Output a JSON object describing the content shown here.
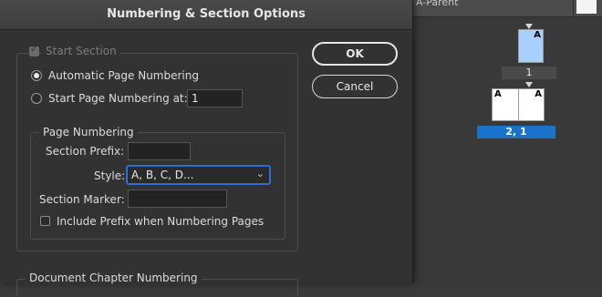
{
  "background_app": {
    "parent_label": "A-Parent",
    "page_a_letter": "A",
    "page_1_number": "1",
    "spread_left_letter": "A",
    "spread_right_letter": "A",
    "spread_number": "2, 1",
    "colors": {
      "selected_page": "#a9cfff",
      "selected_label": "#1a73c9"
    }
  },
  "dialog": {
    "title": "Numbering & Section Options",
    "start_section": {
      "label": "Start Section",
      "checked": true,
      "disabled": true
    },
    "automatic_page_numbering": {
      "label": "Automatic Page Numbering",
      "selected": true
    },
    "start_page_numbering_at": {
      "label": "Start Page Numbering at:",
      "value": "1",
      "selected": false
    },
    "page_numbering": {
      "legend": "Page Numbering",
      "section_prefix": {
        "label": "Section Prefix:",
        "value": ""
      },
      "style": {
        "label": "Style:",
        "value": "A, B, C, D..."
      },
      "section_marker": {
        "label": "Section Marker:",
        "value": ""
      },
      "include_prefix": {
        "label": "Include Prefix when Numbering Pages",
        "checked": false
      }
    },
    "document_chapter_numbering": {
      "legend": "Document Chapter Numbering"
    },
    "buttons": {
      "ok": "OK",
      "cancel": "Cancel"
    }
  }
}
